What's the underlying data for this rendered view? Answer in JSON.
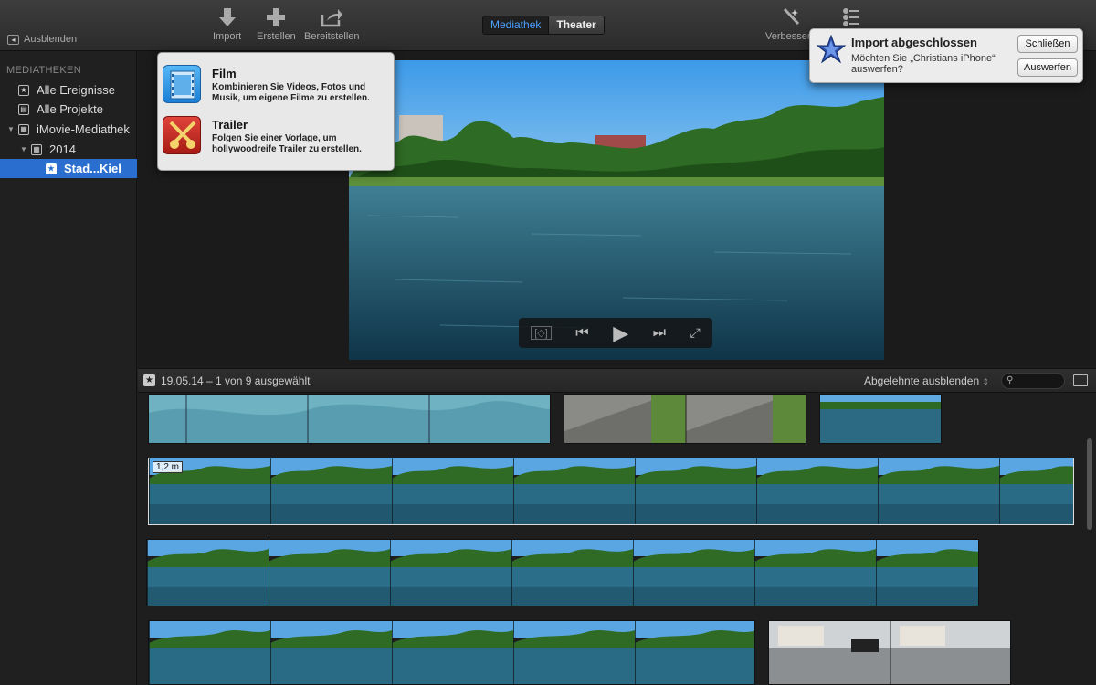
{
  "toolbar": {
    "hide_label": "Ausblenden",
    "import_label": "Import",
    "create_label": "Erstellen",
    "share_label": "Bereitstellen",
    "enhance_label": "Verbessern",
    "tabs": [
      "Mediathek",
      "Theater"
    ]
  },
  "sidebar": {
    "heading": "MEDIATHEKEN",
    "items": [
      {
        "label": "Alle Ereignisse"
      },
      {
        "label": "Alle Projekte"
      },
      {
        "label": "iMovie-Mediathek"
      },
      {
        "label": "2014"
      },
      {
        "label": "Stad...Kiel"
      }
    ]
  },
  "popover": {
    "film_title": "Film",
    "film_desc": "Kombinieren Sie Videos, Fotos und Musik, um eigene Filme zu erstellen.",
    "trailer_title": "Trailer",
    "trailer_desc": "Folgen Sie einer Vorlage, um hollywoodreife Trailer zu erstellen."
  },
  "notification": {
    "title": "Import abgeschlossen",
    "message": "Möchten Sie „Christians iPhone“ auswerfen?",
    "close_label": "Schließen",
    "eject_label": "Auswerfen"
  },
  "browser": {
    "info": "19.05.14 – 1 von 9 ausgewählt",
    "filter": "Abgelehnte ausblenden",
    "duration_badge": "1,2 m"
  },
  "colors": {
    "accent": "#2a6fd0",
    "tab_active": "#4aa3ff"
  }
}
